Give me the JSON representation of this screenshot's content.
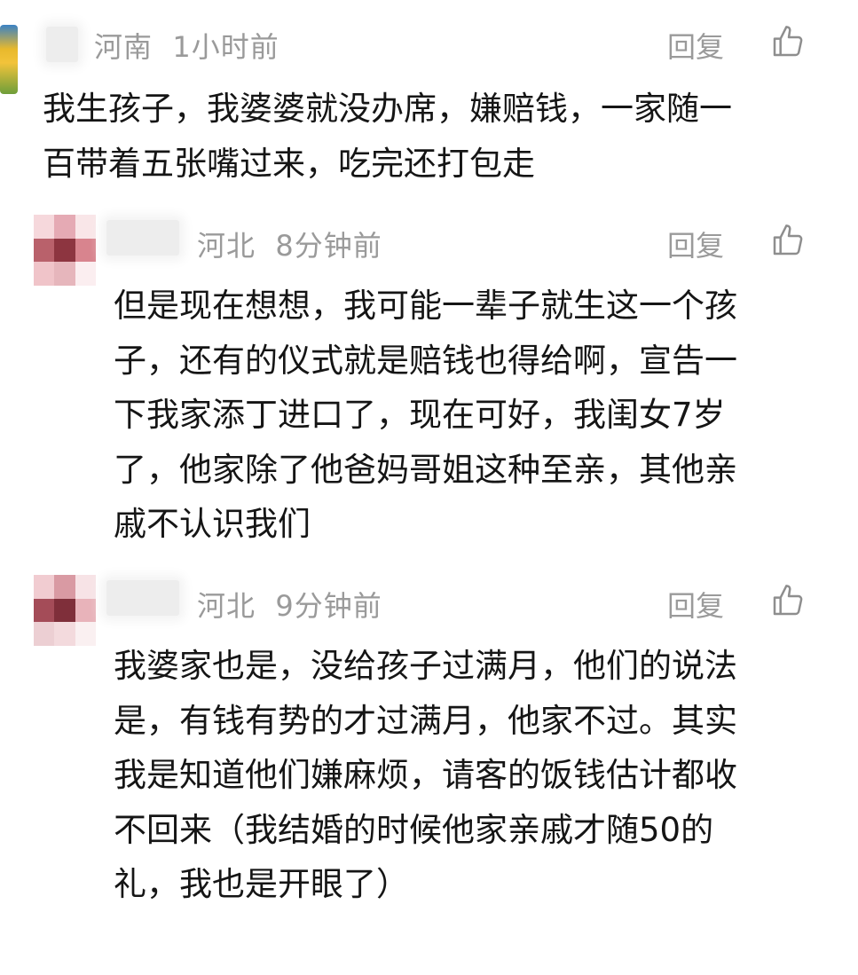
{
  "comments": [
    {
      "region": "河南",
      "time": "1小时前",
      "reply_label": "回复",
      "lines": [
        "我生孩子，我婆婆就没办席，嫌赔钱，一家随一",
        "百带着五张嘴过来，吃完还打包走"
      ]
    },
    {
      "region": "河北",
      "time": "8分钟前",
      "reply_label": "回复",
      "lines": [
        "但是现在想想，我可能一辈子就生这一个孩",
        "子，还有的仪式就是赔钱也得给啊，宣告一",
        "下我家添丁进口了，现在可好，我闺女7岁",
        "了，他家除了他爸妈哥姐这种至亲，其他亲",
        "戚不认识我们"
      ]
    },
    {
      "region": "河北",
      "time": "9分钟前",
      "reply_label": "回复",
      "lines": [
        "我婆家也是，没给孩子过满月，他们的说法",
        "是，有钱有势的才过满月，他家不过。其实",
        "我是知道他们嫌麻烦，请客的饭钱估计都收",
        "不回来（我结婚的时候他家亲戚才随50的",
        "礼，我也是开眼了）"
      ]
    }
  ],
  "colors": {
    "meta": "#9a9a9a",
    "text": "#151515",
    "background": "#ffffff"
  },
  "icons": {
    "like": "thumbs-up-icon"
  }
}
